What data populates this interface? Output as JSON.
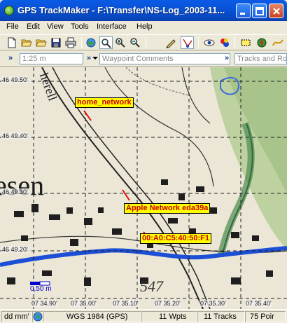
{
  "window": {
    "title": "GPS TrackMaker - F:\\Transfer\\NS-Log_2003-11..."
  },
  "menu": [
    "File",
    "Edit",
    "View",
    "Tools",
    "Interface",
    "Help"
  ],
  "toolbar": {
    "icons": [
      "new-file-icon",
      "open-folder-icon",
      "open-folder-2-icon",
      "save-icon",
      "print-icon",
      "globe-icon",
      "zoom-select-icon",
      "zoom-in-icon",
      "zoom-out-icon",
      "pencil-icon",
      "route-tool-icon",
      "eye-icon",
      "colors-icon",
      "select-area-icon",
      "compass-icon",
      "track-icon"
    ]
  },
  "bar2": {
    "scale_value": "1:25 m",
    "waypoint_placeholder": "Waypoint Comments",
    "tracks_placeholder": "Tracks and Ro"
  },
  "map": {
    "lat_labels": [
      "46 49.50'",
      "46 49.40'",
      "46 49.30'",
      "46 49.20'"
    ],
    "lon_labels": [
      "07 34.90'",
      "07 35.00'",
      "07 35.10'",
      "07 35.20'",
      "07 35.30'",
      "07 35.40'"
    ],
    "waypoints": [
      {
        "label": "home_network"
      },
      {
        "label": "Apple Network eda39a"
      },
      {
        "label": "00:A0:C5:40:50:F1"
      }
    ],
    "scale_text": "0,50 m",
    "colors": {
      "waypoint_bg": "#ffff00",
      "waypoint_text": "#cc0000",
      "track": "#e01010",
      "river": "#1a4fd6",
      "grid": "#222222"
    }
  },
  "status": {
    "format": "dd mm'",
    "datum": "WGS 1984 (GPS)",
    "waypoints": "11 Wpts",
    "tracks": "11 Tracks",
    "points": "75 Poir"
  }
}
